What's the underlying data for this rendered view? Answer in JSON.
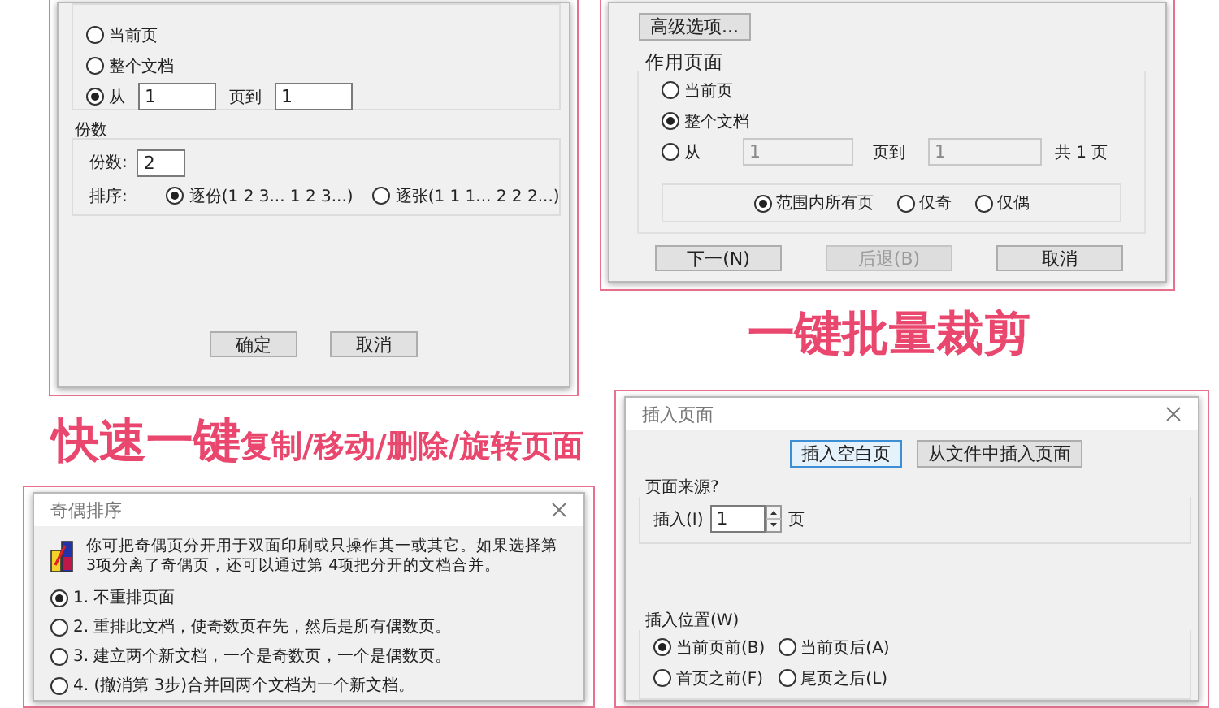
{
  "page_range_dialog": {
    "range_options": [
      {
        "label": "当前页",
        "selected": false
      },
      {
        "label": "整个文档",
        "selected": false
      },
      {
        "label": "从",
        "selected": true
      }
    ],
    "from_field": {
      "value": "1",
      "disabled": false
    },
    "to_label": "页到",
    "to_field": {
      "value": "1",
      "disabled": false
    },
    "copies_group": "份数",
    "copies_label": "份数:",
    "copies_value": "2",
    "order_label": "排序:",
    "order_options": [
      {
        "label": "逐份(1 2 3... 1 2 3...)",
        "selected": true
      },
      {
        "label": "逐张(1 1 1... 2 2 2...)",
        "selected": false
      }
    ],
    "buttons": [
      "确定",
      "取消"
    ]
  },
  "crop_dialog": {
    "advanced_button": "高级选项...",
    "group_title": "作用页面",
    "range_options": [
      {
        "label": "当前页",
        "selected": false
      },
      {
        "label": "整个文档",
        "selected": true
      },
      {
        "label": "从",
        "selected": false
      }
    ],
    "from_field": {
      "value": "1",
      "disabled": true
    },
    "to_label": "页到",
    "to_field": {
      "value": "1",
      "disabled": true
    },
    "total": "共 1 页",
    "subset_options": [
      {
        "label": "范围内所有页",
        "selected": true
      },
      {
        "label": "仅奇",
        "selected": false
      },
      {
        "label": "仅偶",
        "selected": false
      }
    ],
    "buttons": [
      {
        "label": "下一(N)",
        "disabled": false
      },
      {
        "label": "后退(B)",
        "disabled": true
      },
      {
        "label": "取消",
        "disabled": false
      }
    ]
  },
  "headline_crop": "一键批量裁剪",
  "headline_pages": {
    "emphasis": "快速一键",
    "rest": "复制/移动/删除/旋转页面"
  },
  "odd_even_dialog": {
    "title": "奇偶排序",
    "description": "你可把奇偶页分开用于双面印刷或只操作其一或其它。如果选择第 3项分离了奇偶页，还可以通过第 4项把分开的文档合并。",
    "options": [
      {
        "label": "1. 不重排页面",
        "selected": true
      },
      {
        "label": "2. 重排此文档，使奇数页在先，然后是所有偶数页。",
        "selected": false
      },
      {
        "label": "3. 建立两个新文档，一个是奇数页，一个是偶数页。",
        "selected": false
      },
      {
        "label": "4. (撤消第 3步)合并回两个文档为一个新文档。",
        "selected": false
      }
    ]
  },
  "insert_dialog": {
    "title": "插入页面",
    "tabs": [
      {
        "label": "插入空白页",
        "selected": true
      },
      {
        "label": "从文件中插入页面",
        "selected": false
      }
    ],
    "source_group": "页面来源?",
    "insert_label": "插入(I)",
    "insert_value": "1",
    "unit": "页",
    "position_group": "插入位置(W)",
    "position_options": [
      {
        "label": "当前页前(B)",
        "selected": true
      },
      {
        "label": "当前页后(A)",
        "selected": false
      },
      {
        "label": "首页之前(F)",
        "selected": false
      },
      {
        "label": "尾页之后(L)",
        "selected": false
      }
    ]
  }
}
